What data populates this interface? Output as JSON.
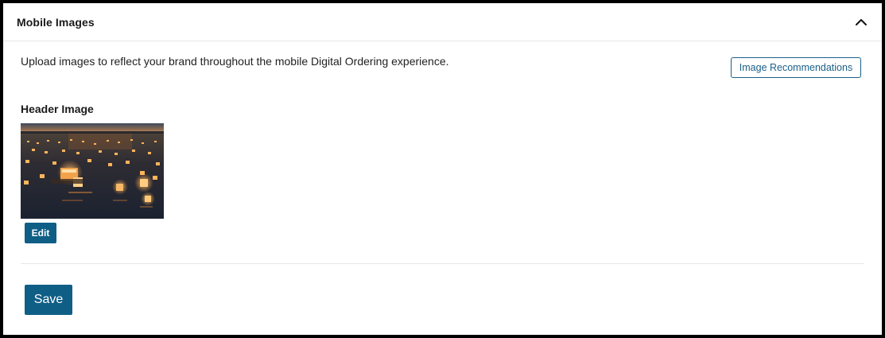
{
  "panel": {
    "title": "Mobile Images",
    "collapse_icon": "chevron-up-icon"
  },
  "main": {
    "description": "Upload images to reflect your brand throughout the mobile Digital Ordering experience.",
    "recommendations_label": "Image Recommendations",
    "header_image": {
      "label": "Header Image",
      "edit_label": "Edit"
    }
  },
  "footer": {
    "save_label": "Save"
  },
  "colors": {
    "accent": "#0f5e86",
    "outline_accent": "#1b6088",
    "frame": "#000000",
    "divider": "#e8e8e8"
  }
}
